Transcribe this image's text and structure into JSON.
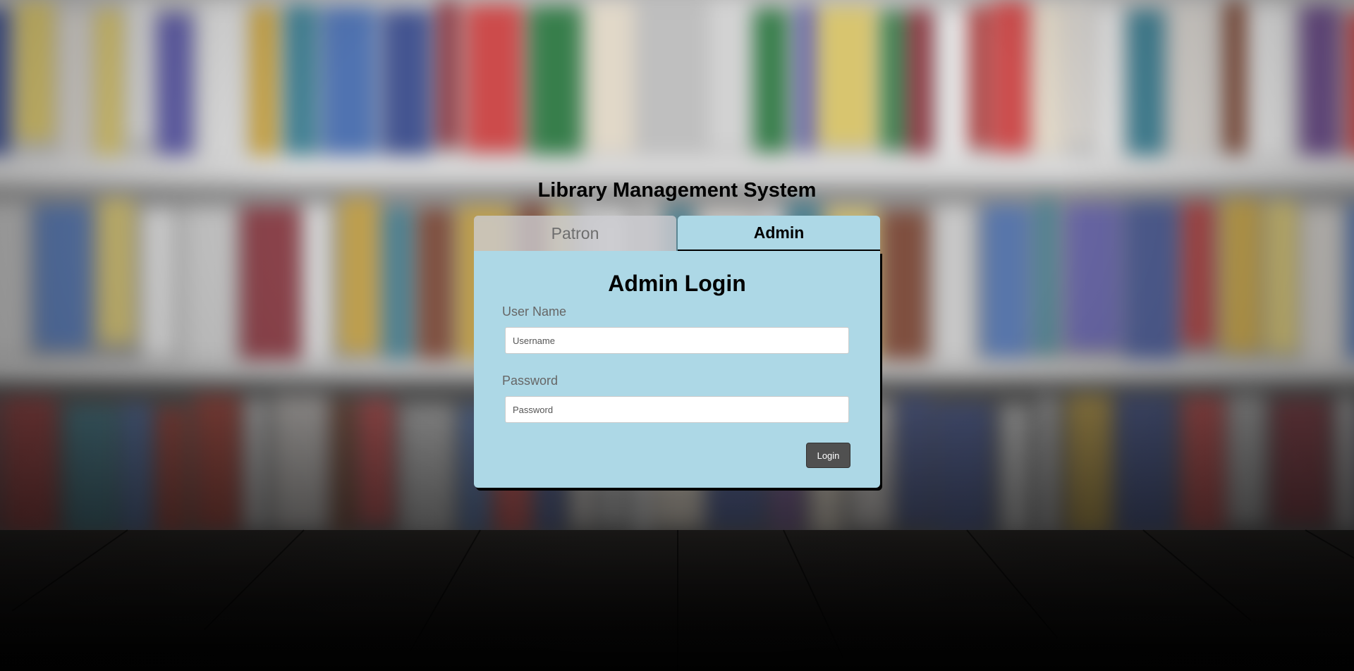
{
  "app": {
    "title": "Library Management System"
  },
  "tabs": [
    {
      "label": "Patron",
      "active": false
    },
    {
      "label": "Admin",
      "active": true
    }
  ],
  "login_form": {
    "heading": "Admin Login",
    "username": {
      "label": "User Name",
      "placeholder": "Username",
      "value": ""
    },
    "password": {
      "label": "Password",
      "placeholder": "Password",
      "value": ""
    },
    "submit_label": "Login"
  },
  "colors": {
    "panel": "#add8e6",
    "inactive_tab": "#cdcdd2",
    "button": "#505050"
  },
  "background": {
    "description_icon": "bookshelf-background"
  }
}
